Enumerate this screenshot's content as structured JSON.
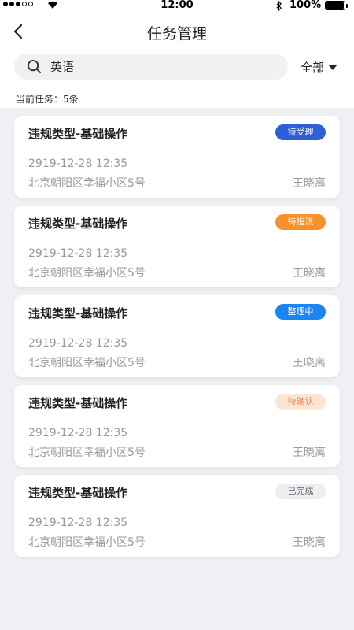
{
  "status_bar": {
    "time": "12:00",
    "battery": "100%"
  },
  "nav": {
    "title": "任务管理"
  },
  "search": {
    "value": "英语"
  },
  "filter": {
    "label": "全部"
  },
  "summary": {
    "text": "当前任务：5条"
  },
  "tasks": [
    {
      "title": "违规类型-基础操作",
      "status": "待受理",
      "time": "2919-12-28 12:35",
      "address": "北京朝阳区幸福小区5号",
      "person": "王晓离"
    },
    {
      "title": "违规类型-基础操作",
      "status": "待指派",
      "time": "2919-12-28 12:35",
      "address": "北京朝阳区幸福小区5号",
      "person": "王晓离"
    },
    {
      "title": "违规类型-基础操作",
      "status": "整理中",
      "time": "2919-12-28 12:35",
      "address": "北京朝阳区幸福小区5号",
      "person": "王晓离"
    },
    {
      "title": "违规类型-基础操作",
      "status": "待确认",
      "time": "2919-12-28 12:35",
      "address": "北京朝阳区幸福小区5号",
      "person": "王晓离"
    },
    {
      "title": "违规类型-基础操作",
      "status": "已完成",
      "time": "2919-12-28 12:35",
      "address": "北京朝阳区幸福小区5号",
      "person": "王晓离"
    }
  ],
  "colors": {
    "badge_pending_bg": "#2f5fd6",
    "badge_assign_bg": "#f5922e",
    "badge_sorting_bg": "#1a84f0",
    "badge_confirm_bg": "#fde5d4",
    "badge_confirm_text": "#ef8a4c",
    "badge_done_bg": "#eceef1",
    "badge_done_text": "#666666"
  }
}
